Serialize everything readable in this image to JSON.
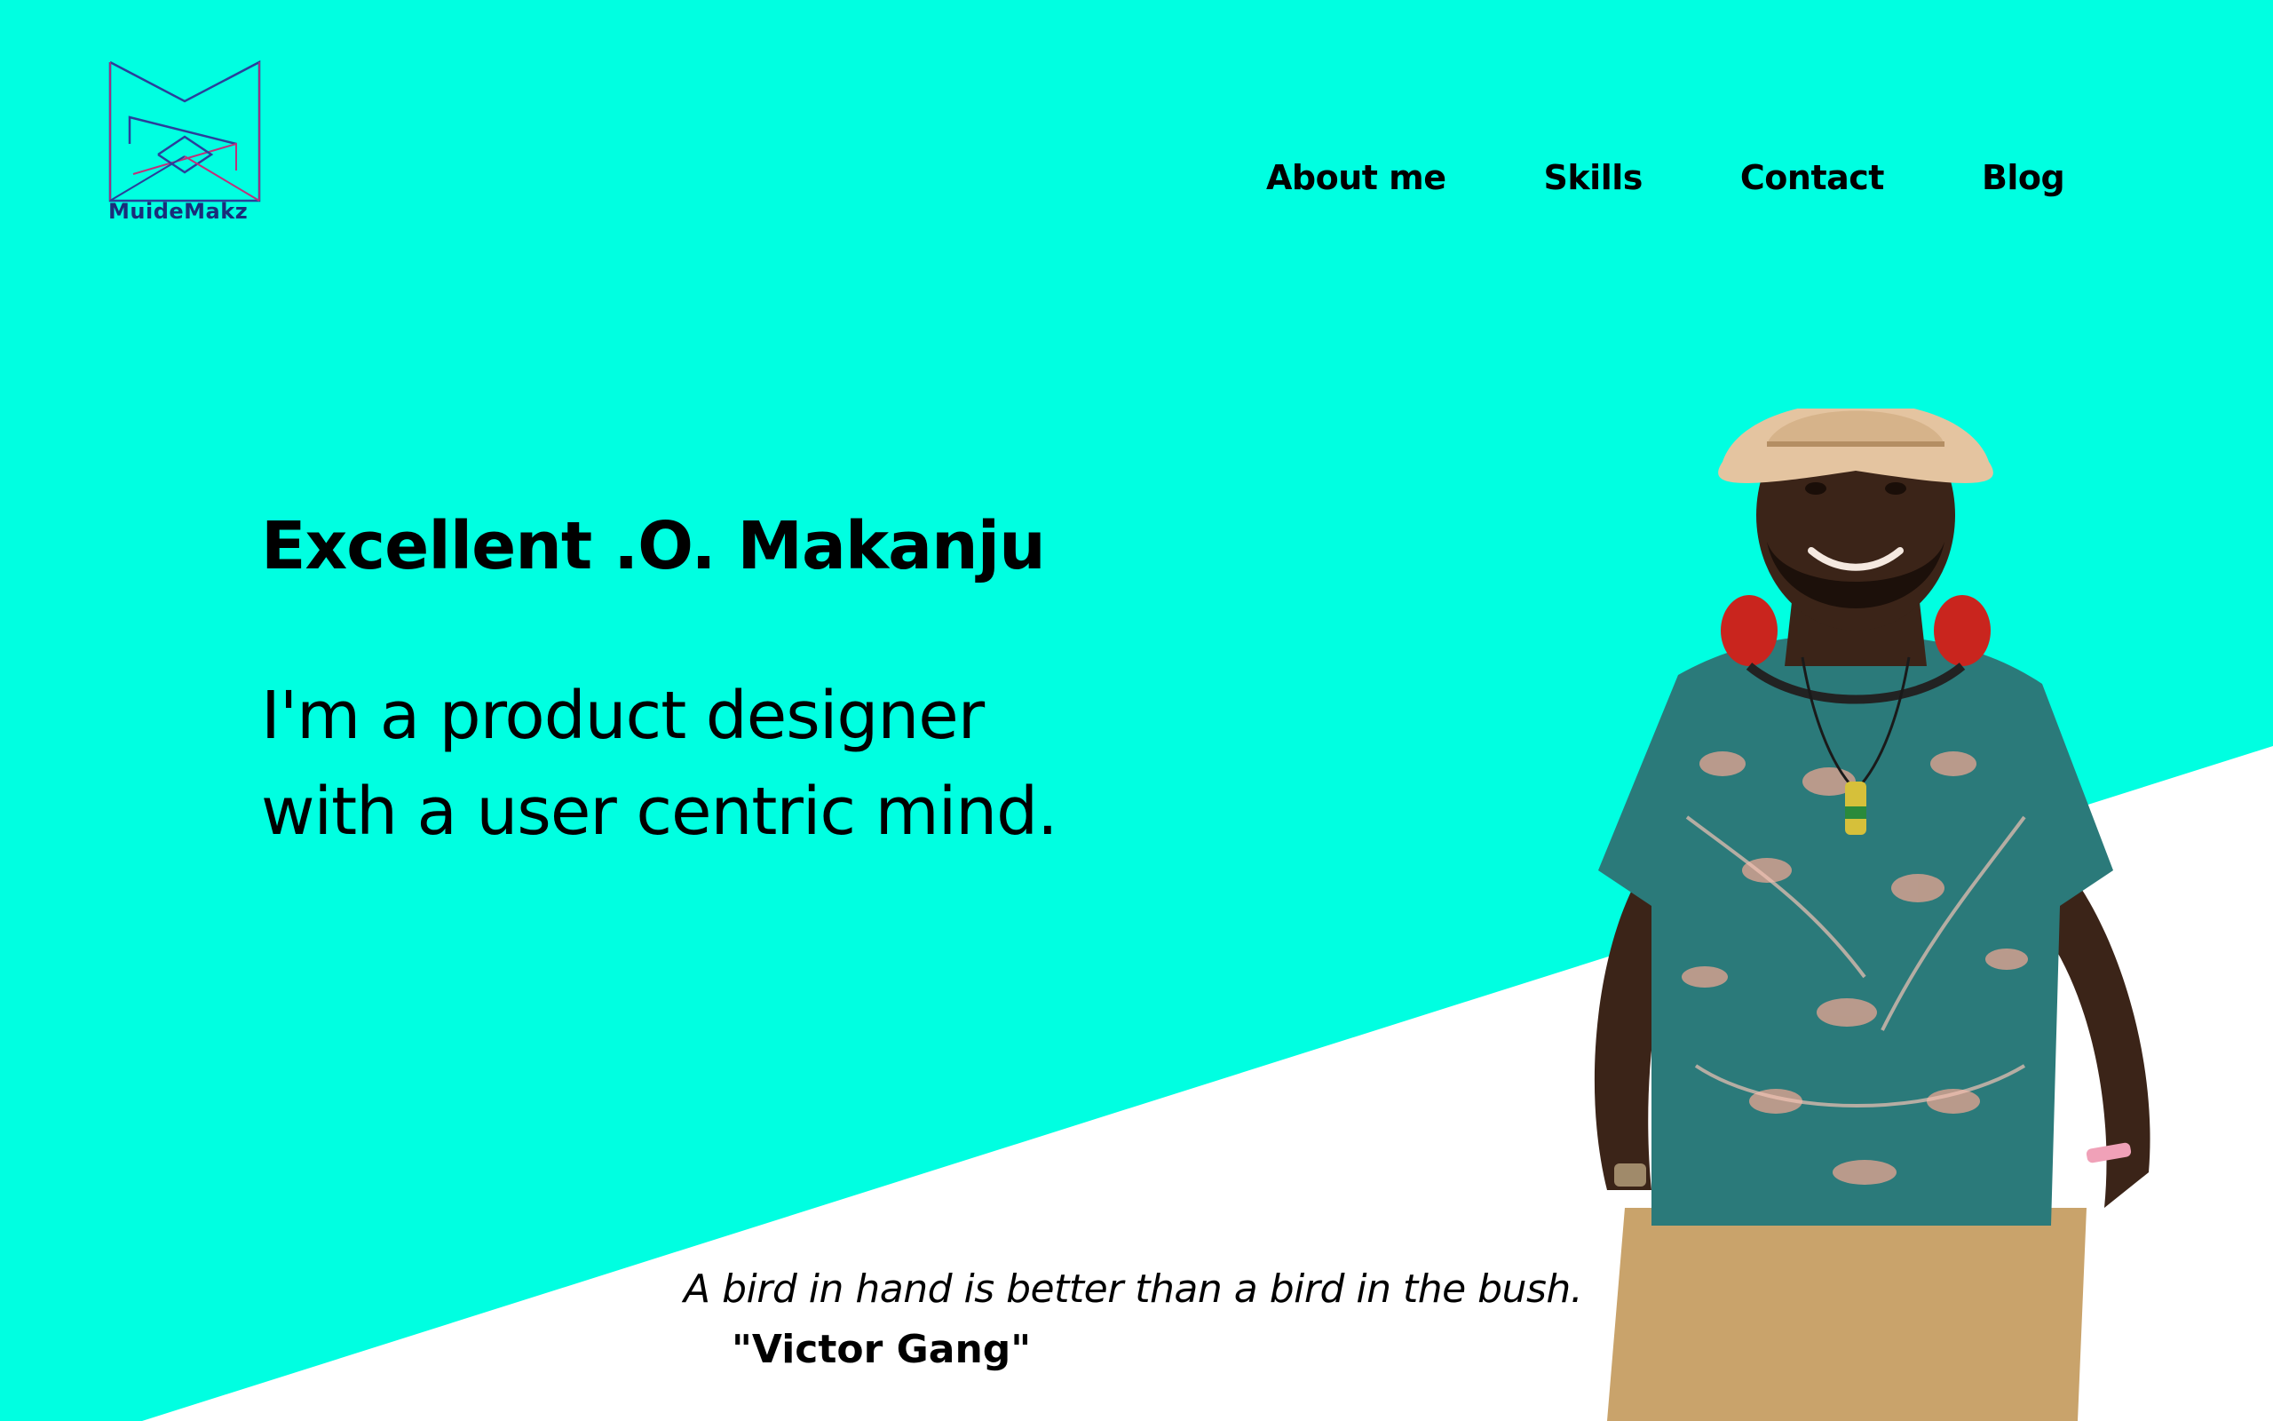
{
  "brand": {
    "logo_text": "MuideMakz",
    "logo_icon": "monogram-m-logo",
    "colors": {
      "background": "#00FFE1",
      "diagonal": "#FFFFFF",
      "logo_stroke": "#2a3f9a",
      "logo_accent": "#c0307a",
      "text": "#000000"
    }
  },
  "nav": {
    "items": [
      {
        "label": "About me"
      },
      {
        "label": "Skills"
      },
      {
        "label": "Contact"
      },
      {
        "label": "Blog"
      }
    ]
  },
  "hero": {
    "name": "Excellent .O. Makanju",
    "tagline_line1": "I'm a product designer",
    "tagline_line2": "with a user centric mind."
  },
  "quote": {
    "text": "A bird in hand is better than a bird in the bush.",
    "author": "\"Victor Gang\""
  },
  "portrait": {
    "icon": "person-portrait-image"
  }
}
